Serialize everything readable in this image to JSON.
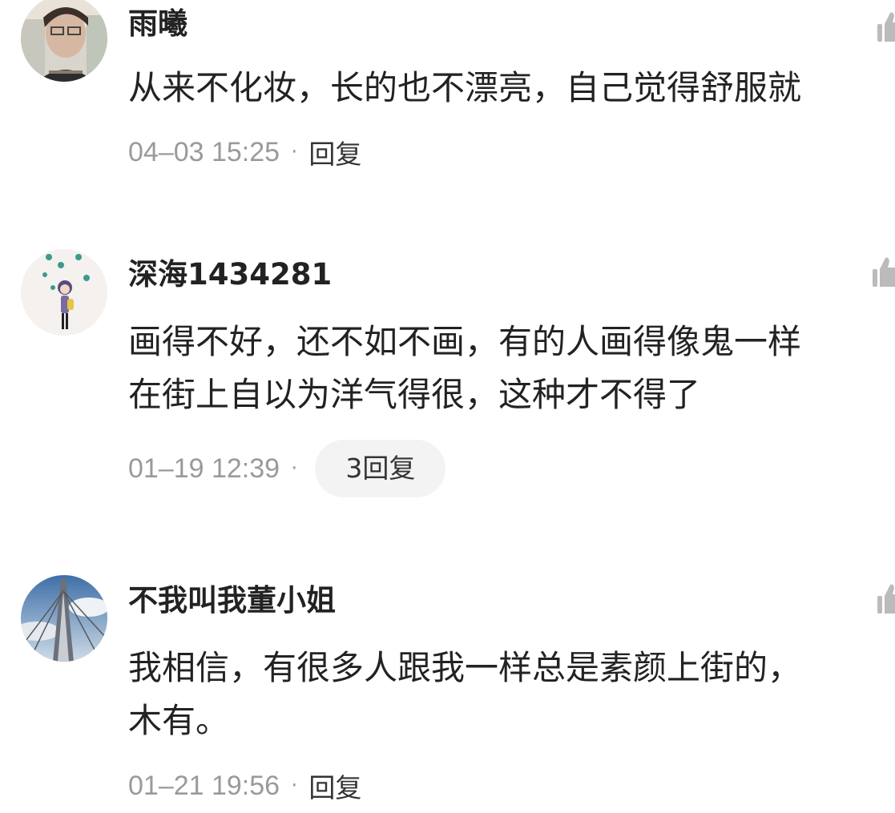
{
  "comments": [
    {
      "username": "雨曦",
      "lines": [
        "从来不化妆，长的也不漂亮，自己觉得舒服就"
      ],
      "time": "04–03 15:25",
      "separator": "·",
      "reply_label": "回复",
      "avatar_icon": "avatar-photo-woman-glasses",
      "like_icon": "thumbs-up-icon"
    },
    {
      "username": "深海1434281",
      "lines": [
        "画得不好，还不如不画，有的人画得像鬼一样",
        "在街上自以为洋气得很，这种才不得了"
      ],
      "time": "01–19 12:39",
      "separator": "·",
      "reply_label": "3回复",
      "avatar_icon": "avatar-cartoon-girl-bubbles",
      "like_icon": "thumbs-up-icon"
    },
    {
      "username": "不我叫我董小姐",
      "lines": [
        "我相信，有很多人跟我一样总是素颜上街的，",
        "木有。"
      ],
      "time": "01–21 19:56",
      "separator": "·",
      "reply_label": "回复",
      "avatar_icon": "avatar-photo-bridge-sky",
      "like_icon": "thumbs-up-icon"
    }
  ],
  "colors": {
    "username": "#222222",
    "body_text": "#222222",
    "timestamp": "#9a9a9a",
    "reply_pill_bg": "#f3f3f3",
    "like_icon": "#bbbbbb"
  }
}
